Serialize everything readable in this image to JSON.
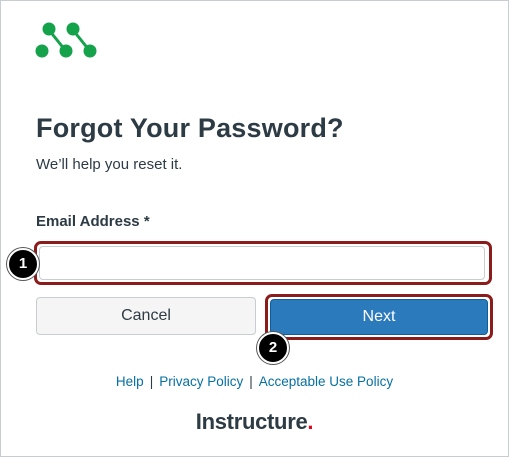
{
  "logo": {
    "icon": "canvas-dots-logo-icon",
    "color": "#14a34a"
  },
  "page": {
    "title": "Forgot Your Password?",
    "subtitle": "We’ll help you reset it."
  },
  "form": {
    "email_label": "Email Address *",
    "email_value": "",
    "email_placeholder": ""
  },
  "buttons": {
    "cancel_label": "Cancel",
    "next_label": "Next"
  },
  "callouts": {
    "one": "1",
    "two": "2"
  },
  "footer": {
    "links": [
      "Help",
      "Privacy Policy",
      "Acceptable Use Policy"
    ],
    "separator": "|",
    "brand_name": "Instructure",
    "brand_dot": "."
  },
  "colors": {
    "primary_button": "#2b7abc",
    "link": "#0770a3",
    "highlight_border": "#8c1b1b",
    "brand_accent": "#e0061f"
  }
}
